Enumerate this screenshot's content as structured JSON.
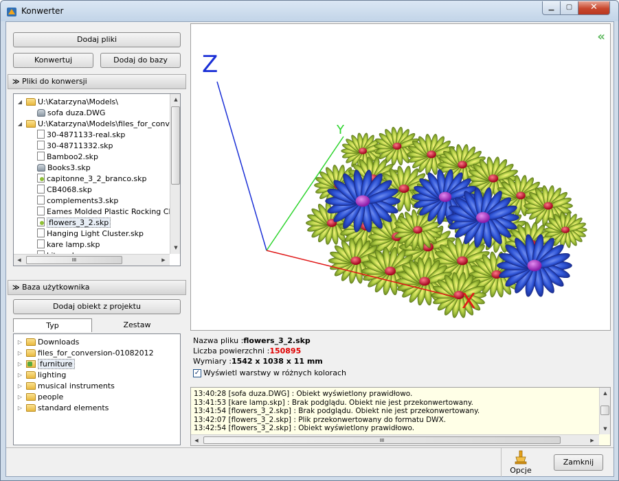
{
  "window": {
    "title": "Konwerter",
    "minimize_icon": "minimize-icon",
    "maximize_icon": "maximize-icon",
    "close_icon": "close-icon"
  },
  "toolbar": {
    "add_files": "Dodaj pliki",
    "convert": "Konwertuj",
    "add_to_db": "Dodaj do bazy"
  },
  "files_section": {
    "header": "Pliki do konwersji",
    "items": [
      {
        "label": "U:\\Katarzyna\\Models\\",
        "icon": "folder-icon",
        "level": 0,
        "expander": "◢"
      },
      {
        "label": "sofa duza.DWG",
        "icon": "dwg-file-icon",
        "level": 1
      },
      {
        "label": "U:\\Katarzyna\\Models\\files_for_conver",
        "icon": "folder-icon",
        "level": 0,
        "expander": "◢"
      },
      {
        "label": "30-4871133-real.skp",
        "icon": "file-icon",
        "level": 1
      },
      {
        "label": "30-48711332.skp",
        "icon": "file-icon",
        "level": 1
      },
      {
        "label": "Bamboo2.skp",
        "icon": "file-icon",
        "level": 1
      },
      {
        "label": "Books3.skp",
        "icon": "dwg-file-icon",
        "level": 1
      },
      {
        "label": "capitonne_3_2_branco.skp",
        "icon": "preview-file-icon",
        "level": 1
      },
      {
        "label": "CB4068.skp",
        "icon": "file-icon",
        "level": 1
      },
      {
        "label": "complements3.skp",
        "icon": "file-icon",
        "level": 1
      },
      {
        "label": "Eames Molded Plastic Rocking Chai",
        "icon": "file-icon",
        "level": 1
      },
      {
        "label": "flowers_3_2.skp",
        "icon": "preview-file-icon",
        "level": 1,
        "selected": true
      },
      {
        "label": "Hanging Light Cluster.skp",
        "icon": "file-icon",
        "level": 1
      },
      {
        "label": "kare lamp.skp",
        "icon": "file-icon",
        "level": 1
      },
      {
        "label": "kitap.skp",
        "icon": "file-icon",
        "level": 1
      }
    ],
    "hscroll_glyph": "III"
  },
  "user_db": {
    "header": "Baza użytkownika",
    "add_object": "Dodaj obiekt z projektu",
    "tabs": [
      "Typ",
      "Zestaw"
    ],
    "items": [
      {
        "label": "Downloads",
        "icon": "folder-icon"
      },
      {
        "label": "files_for_conversion-01082012",
        "icon": "folder-icon"
      },
      {
        "label": "furniture",
        "icon": "furniture-folder-icon",
        "selected": true
      },
      {
        "label": "lighting",
        "icon": "folder-icon"
      },
      {
        "label": "musical instruments",
        "icon": "folder-icon"
      },
      {
        "label": "people",
        "icon": "folder-icon"
      },
      {
        "label": "standard elements",
        "icon": "folder-icon"
      }
    ]
  },
  "viewer": {
    "axis_z": "Z",
    "axis_y": "Y",
    "axis_x": "X",
    "collapse_glyph": "«"
  },
  "info": {
    "filename_label": "Nazwa pliku :",
    "filename_value": "flowers_3_2.skp",
    "surfaces_label": "Liczba powierzchni :",
    "surfaces_value": "150895",
    "dims_label": "Wymiary :",
    "dims_value": "1542 x 1038 x 11 mm",
    "layers_label": "Wyświetl warstwy w różnych kolorach",
    "layers_checked": true
  },
  "log": {
    "lines": [
      "13:40:28 [sofa duza.DWG] : Obiekt wyświetlony prawidłowo.",
      "13:41:53 [kare lamp.skp] : Brak podglądu. Obiekt nie jest przekonwertowany.",
      "13:41:54 [flowers_3_2.skp] : Brak podglądu. Obiekt nie jest przekonwertowany.",
      "13:42:07 [flowers_3_2.skp] : Plik przekonwertowany do formatu DWX.",
      "13:42:54 [flowers_3_2.skp] : Obiekt wyświetlony prawidłowo."
    ],
    "hscroll_glyph": "III"
  },
  "footer": {
    "options": "Opcje",
    "close": "Zamknij"
  },
  "colors": {
    "axis_z": "#1a2fd6",
    "axis_y": "#2bd42b",
    "axis_x": "#e01818",
    "accent_green": "#5cb85c",
    "surfaces": "#e00000"
  }
}
